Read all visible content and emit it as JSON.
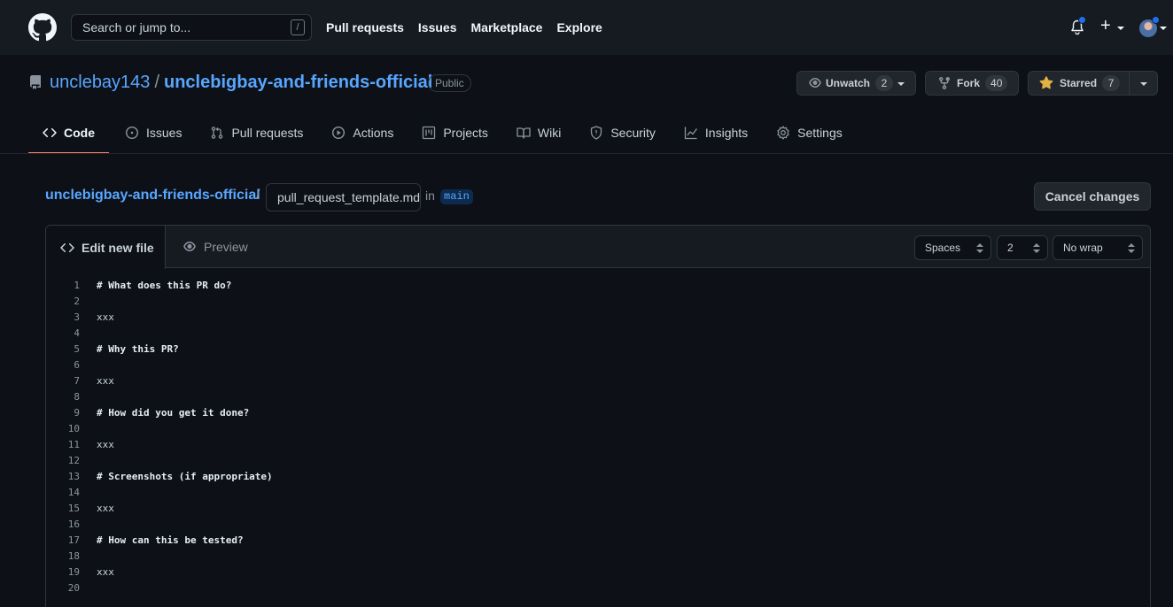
{
  "header": {
    "search_placeholder": "Search or jump to...",
    "search_shortcut": "/",
    "nav": [
      "Pull requests",
      "Issues",
      "Marketplace",
      "Explore"
    ],
    "new_label": "+"
  },
  "repo": {
    "owner": "unclebay143",
    "separator": "/",
    "name": "unclebigbay-and-friends-official",
    "visibility": "Public",
    "unwatch_label": "Unwatch",
    "watch_count": "2",
    "fork_label": "Fork",
    "fork_count": "40",
    "star_label": "Starred",
    "star_count": "7"
  },
  "tabs": [
    {
      "label": "Code",
      "icon": "code-icon",
      "active": true
    },
    {
      "label": "Issues",
      "icon": "issue-icon"
    },
    {
      "label": "Pull requests",
      "icon": "pull-request-icon"
    },
    {
      "label": "Actions",
      "icon": "play-icon"
    },
    {
      "label": "Projects",
      "icon": "project-icon"
    },
    {
      "label": "Wiki",
      "icon": "book-icon"
    },
    {
      "label": "Security",
      "icon": "shield-icon"
    },
    {
      "label": "Insights",
      "icon": "graph-icon"
    },
    {
      "label": "Settings",
      "icon": "gear-icon"
    }
  ],
  "breadcrumb": {
    "repo": "unclebigbay-and-friends-official",
    "slash": "/",
    "filename_value": "pull_request_template.md",
    "in_label": "in",
    "branch": "main",
    "cancel_label": "Cancel changes"
  },
  "editor": {
    "edit_tab": "Edit new file",
    "preview_tab": "Preview",
    "indent_mode": "Spaces",
    "indent_size": "2",
    "wrap_mode": "No wrap",
    "lines": [
      "# What does this PR do?",
      "",
      "xxx",
      "",
      "# Why this PR?",
      "",
      "xxx",
      "",
      "# How did you get it done?",
      "",
      "xxx",
      "",
      "# Screenshots (if appropriate)",
      "",
      "xxx",
      "",
      "# How can this be tested?",
      "",
      "xxx",
      ""
    ]
  },
  "colors": {
    "background": "#0d1117",
    "header": "#161b22",
    "link": "#58a6ff",
    "active_tab_underline": "#f78166",
    "star": "#e3b341"
  }
}
